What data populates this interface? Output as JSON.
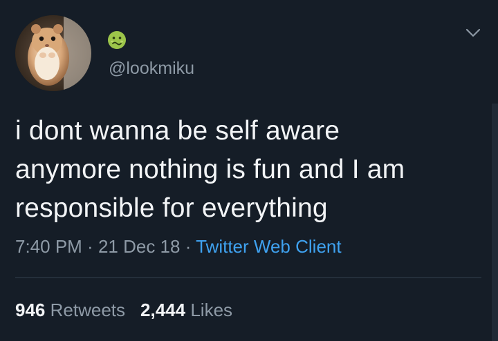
{
  "tweet": {
    "avatar_icon": "hamster-avatar",
    "emoji_icon": "nauseated-face-emoji",
    "handle": "@lookmiku",
    "menu_icon": "chevron-down-icon",
    "text_lines": [
      "i dont wanna be self aware",
      "anymore nothing is fun and I am",
      "responsible for everything"
    ],
    "time": "7:40 PM",
    "separator": " · ",
    "date": "21 Dec 18",
    "client": "Twitter Web Client",
    "retweets_count": "946",
    "retweets_label": "Retweets",
    "likes_count": "2,444",
    "likes_label": "Likes"
  },
  "colors": {
    "background": "#151d27",
    "primary_text": "#f2f4f6",
    "secondary_text": "#8e9aa6",
    "link": "#3fa2f0",
    "divider": "#33404d"
  }
}
